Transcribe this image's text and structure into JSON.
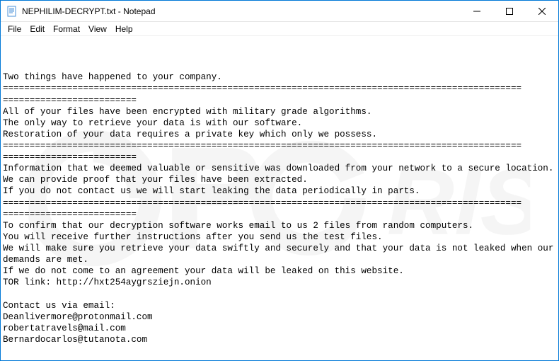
{
  "window": {
    "title": "NEPHILIM-DECRYPT.txt - Notepad"
  },
  "menubar": {
    "items": [
      "File",
      "Edit",
      "Format",
      "View",
      "Help"
    ]
  },
  "content": {
    "text": "Two things have happened to your company.\n=================================================================================================\n=========================\nAll of your files have been encrypted with military grade algorithms.\nThe only way to retrieve your data is with our software.\nRestoration of your data requires a private key which only we possess.\n=================================================================================================\n=========================\nInformation that we deemed valuable or sensitive was downloaded from your network to a secure location.\nWe can provide proof that your files have been extracted.\nIf you do not contact us we will start leaking the data periodically in parts.\n=================================================================================================\n=========================\nTo confirm that our decryption software works email to us 2 files from random computers.\nYou will receive further instructions after you send us the test files.\nWe will make sure you retrieve your data swiftly and securely and that your data is not leaked when our demands are met.\nIf we do not come to an agreement your data will be leaked on this website.\nTOR link: http://hxt254aygrsziejn.onion\n\nContact us via email:\nDeanlivermore@protonmail.com\nrobertatravels@mail.com\nBernardocarlos@tutanota.com"
  }
}
